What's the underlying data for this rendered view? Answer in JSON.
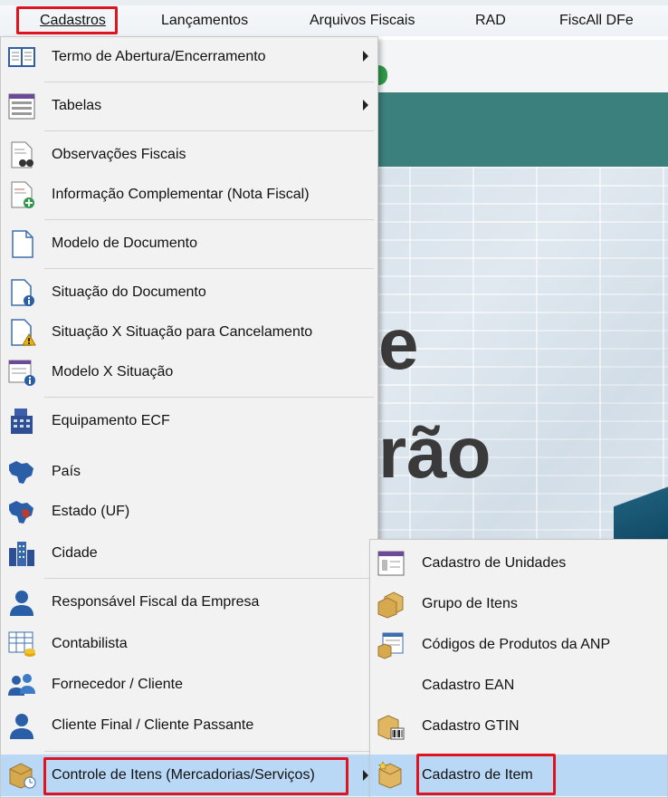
{
  "menubar": {
    "items": [
      "Cadastros",
      "Lançamentos",
      "Arquivos Fiscais",
      "RAD",
      "FiscAll DFe"
    ]
  },
  "background": {
    "hero_word_1": "e",
    "hero_word_2": "rão"
  },
  "main_menu": {
    "items": [
      {
        "label": "Termo de Abertura/Encerramento",
        "icon": "book-icon",
        "submenu": true
      },
      {
        "label": "Tabelas",
        "icon": "table-list-icon",
        "submenu": true
      },
      {
        "label": "Observações Fiscais",
        "icon": "document-binoculars-icon"
      },
      {
        "label": "Informação Complementar (Nota Fiscal)",
        "icon": "document-add-icon"
      },
      {
        "label": "Modelo de Documento",
        "icon": "blank-document-icon"
      },
      {
        "label": "Situação do Documento",
        "icon": "document-info-icon"
      },
      {
        "label": "Situação X Situação para Cancelamento",
        "icon": "document-warning-icon"
      },
      {
        "label": "Modelo X Situação",
        "icon": "form-info-icon"
      },
      {
        "label": "Equipamento ECF",
        "icon": "cash-register-icon"
      },
      {
        "label": "País",
        "icon": "brazil-map-icon"
      },
      {
        "label": "Estado (UF)",
        "icon": "brazil-state-map-icon"
      },
      {
        "label": "Cidade",
        "icon": "city-buildings-icon"
      },
      {
        "label": "Responsável Fiscal da Empresa",
        "icon": "user-icon"
      },
      {
        "label": "Contabilista",
        "icon": "spreadsheet-coins-icon"
      },
      {
        "label": "Fornecedor / Cliente",
        "icon": "users-group-icon"
      },
      {
        "label": "Cliente Final / Cliente Passante",
        "icon": "user-icon"
      },
      {
        "label": "Controle de Itens (Mercadorias/Serviços)",
        "icon": "box-clock-icon",
        "submenu": true
      }
    ]
  },
  "sub_menu": {
    "items": [
      {
        "label": "Cadastro de Unidades",
        "icon": "units-window-icon"
      },
      {
        "label": "Grupo de Itens",
        "icon": "boxes-icon"
      },
      {
        "label": "Códigos de Produtos da ANP",
        "icon": "list-box-icon"
      },
      {
        "label": "Cadastro EAN",
        "icon": ""
      },
      {
        "label": "Cadastro GTIN",
        "icon": "box-barcode-icon"
      },
      {
        "label": "Cadastro de Item",
        "icon": "box-star-icon"
      }
    ]
  },
  "colors": {
    "highlight": "#b9d8f5",
    "callout_red": "#e0141e",
    "banner_teal": "#3b807c"
  }
}
